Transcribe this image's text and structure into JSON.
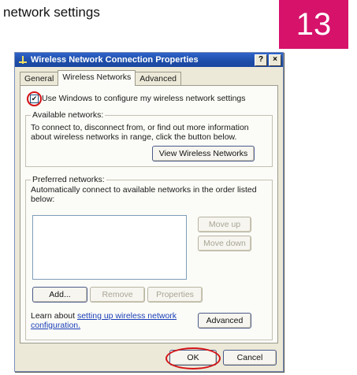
{
  "heading": "network settings",
  "step_number": "13",
  "dialog": {
    "title": "Wireless Network Connection Properties",
    "help_button": "?",
    "close_button": "×",
    "tabs": [
      "General",
      "Wireless Networks",
      "Advanced"
    ],
    "use_windows_checkbox": {
      "label": "Use Windows to configure my wireless network settings",
      "checked": true
    },
    "available_networks": {
      "legend": "Available networks:",
      "text_line1": "To connect to, disconnect from, or find out more information",
      "text_line2": "about wireless networks in range, click the button below.",
      "view_button": "View Wireless Networks"
    },
    "preferred_networks": {
      "legend": "Preferred networks:",
      "text_line1": "Automatically connect to available networks in the order listed",
      "text_line2": "below:",
      "move_up": "Move up",
      "move_down": "Move down",
      "add": "Add...",
      "remove": "Remove",
      "properties": "Properties"
    },
    "learn_prefix": "Learn about ",
    "learn_link_line1": "setting up wireless network",
    "learn_link_line2": "configuration.",
    "advanced_button": "Advanced",
    "ok_button": "OK",
    "cancel_button": "Cancel"
  },
  "colors": {
    "badge": "#d6126b",
    "highlight_ring": "#d51418",
    "titlebar": "#1e4ea8"
  }
}
